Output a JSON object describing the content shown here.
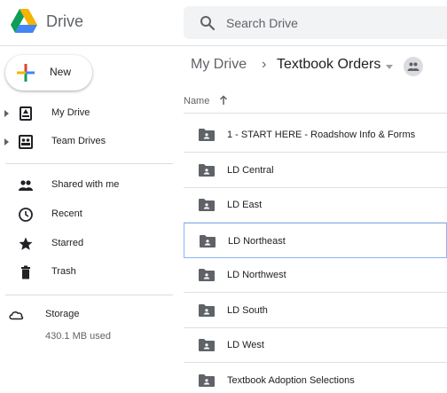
{
  "header": {
    "app_title": "Drive",
    "search_placeholder": "Search Drive",
    "logo_icon": "google-drive-logo",
    "colors": {
      "green": "#0f9d58",
      "yellow": "#f4b400",
      "blue": "#4285f4",
      "red": "#db4437"
    }
  },
  "sidebar": {
    "new_label": "New",
    "items": [
      {
        "label": "My Drive",
        "icon": "my-drive-icon",
        "expandable": true
      },
      {
        "label": "Team Drives",
        "icon": "team-drives-icon",
        "expandable": true
      },
      {
        "label": "Shared with me",
        "icon": "shared-icon",
        "expandable": false
      },
      {
        "label": "Recent",
        "icon": "clock-icon",
        "expandable": false
      },
      {
        "label": "Starred",
        "icon": "star-icon",
        "expandable": false
      },
      {
        "label": "Trash",
        "icon": "trash-icon",
        "expandable": false
      }
    ],
    "storage": {
      "label": "Storage",
      "used": "430.1 MB used",
      "icon": "cloud-icon"
    }
  },
  "main": {
    "breadcrumb": {
      "root": "My Drive",
      "separator": "›",
      "current": "Textbook Orders"
    },
    "columns": {
      "name": "Name"
    },
    "files": [
      {
        "name": "1 - START HERE - Roadshow Info & Forms",
        "selected": false
      },
      {
        "name": "LD Central",
        "selected": false
      },
      {
        "name": "LD East",
        "selected": false
      },
      {
        "name": "LD Northeast",
        "selected": true
      },
      {
        "name": "LD Northwest",
        "selected": false
      },
      {
        "name": "LD South",
        "selected": false
      },
      {
        "name": "LD West",
        "selected": false
      },
      {
        "name": "Textbook Adoption Selections",
        "selected": false
      }
    ]
  }
}
